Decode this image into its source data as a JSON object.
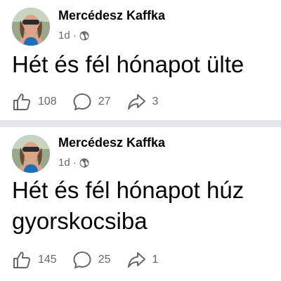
{
  "posts": [
    {
      "author": "Mercédesz Kaffka",
      "time": "1d",
      "separator": "·",
      "privacy_icon": "globe-icon",
      "text_lines": [
        "Hét és fél hónapot ülte"
      ],
      "likes": "108",
      "comments": "27",
      "shares": "3"
    },
    {
      "author": "Mercédesz Kaffka",
      "time": "1d",
      "separator": "·",
      "privacy_icon": "globe-icon",
      "text_lines": [
        "Hét és fél hónapot húz",
        "gyorskocsiba"
      ],
      "likes": "145",
      "comments": "25",
      "shares": "1"
    }
  ],
  "colors": {
    "text_primary": "#050505",
    "text_secondary": "#65676b",
    "separator": "#e4e6eb"
  }
}
